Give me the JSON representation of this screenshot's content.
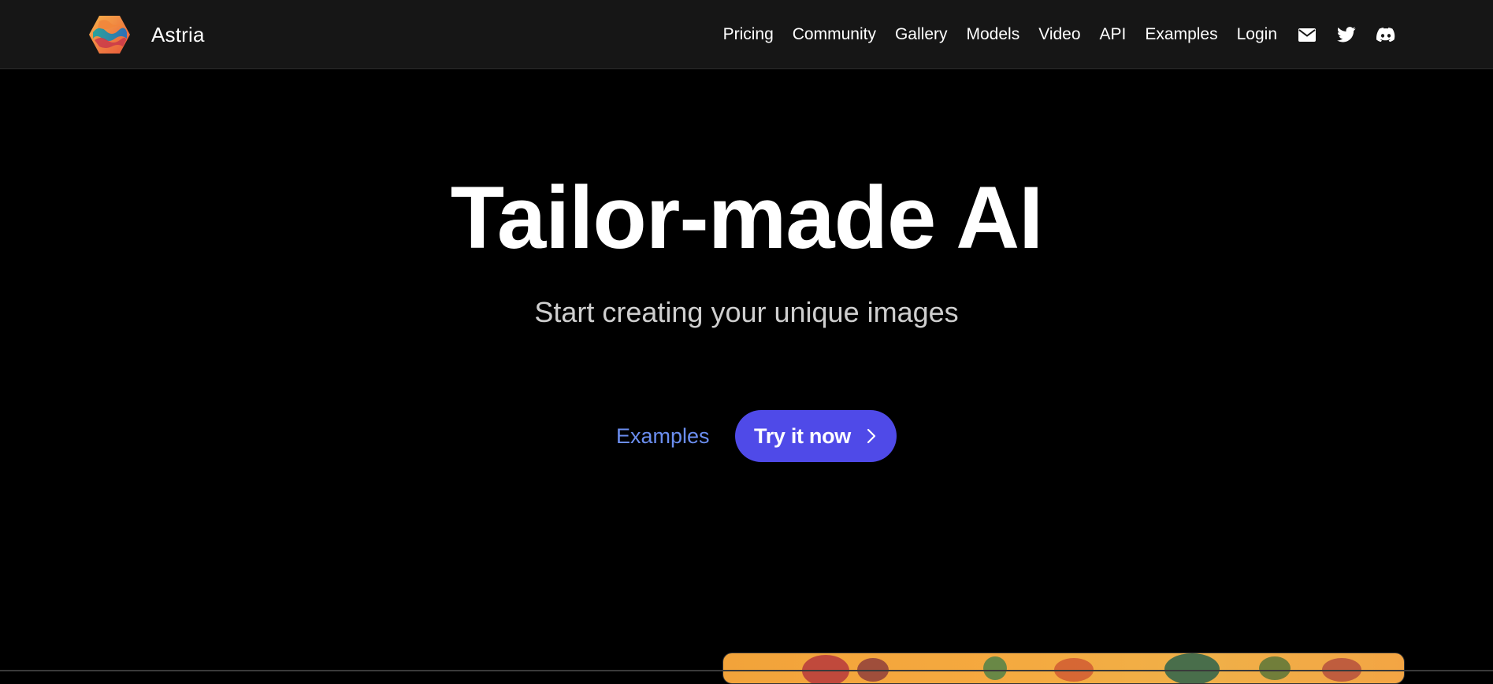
{
  "brand": {
    "name": "Astria",
    "logo_icon": "astria-hexagon-logo-icon"
  },
  "nav": {
    "links": [
      "Pricing",
      "Community",
      "Gallery",
      "Models",
      "Video",
      "API",
      "Examples",
      "Login"
    ],
    "icons": [
      "email-icon",
      "twitter-icon",
      "discord-icon"
    ]
  },
  "hero": {
    "title": "Tailor-made AI",
    "subtitle": "Start creating your unique images",
    "examples_label": "Examples",
    "cta_label": "Try it now"
  },
  "colors": {
    "page_background": "#000000",
    "navbar_background": "#161616",
    "accent_button": "#4f4ae8",
    "link_blue": "#6b8ef0",
    "subtitle_gray": "#cfcfcf"
  }
}
